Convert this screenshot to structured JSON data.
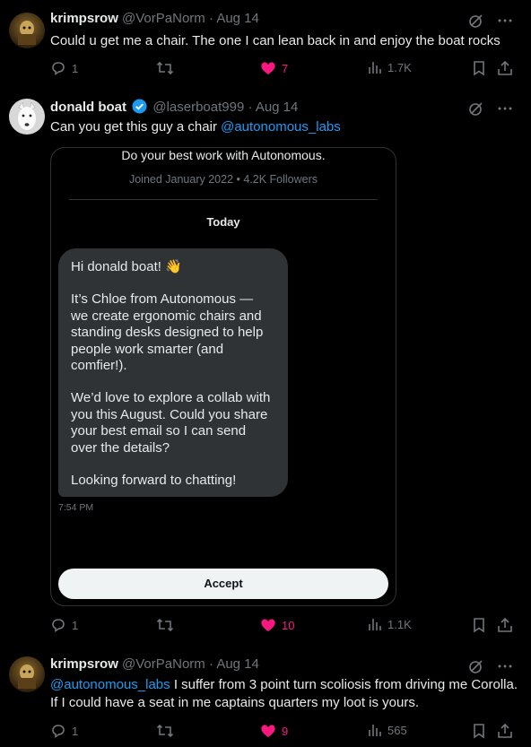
{
  "tweets": [
    {
      "name": "krimpsrow",
      "handle": "@VorPaNorm",
      "sep": "·",
      "date": "Aug 14",
      "text": "Could u get me a chair. The one I can lean back in and enjoy the boat rocks",
      "replies": "1",
      "likes": "7",
      "views": "1.7K"
    },
    {
      "name": "donald boat",
      "handle": "@laserboat999",
      "sep": "·",
      "date": "Aug 14",
      "text_prefix": "Can you get this guy a chair ",
      "mention": "@autonomous_labs",
      "replies": "1",
      "likes": "10",
      "views": "1.1K"
    },
    {
      "name": "krimpsrow",
      "handle": "@VorPaNorm",
      "sep": "·",
      "date": "Aug 14",
      "mention": "@autonomous_labs",
      "text_suffix": " I suffer from 3 point turn scoliosis from driving me Corolla. If I could have a seat in me captains quarters my loot is yours.",
      "replies": "1",
      "likes": "9",
      "views": "565"
    }
  ],
  "card": {
    "tagline": "Do your best work with Autonomous.",
    "joined": "Joined January 2022 • 4.2K Followers",
    "today": "Today",
    "greeting": "Hi donald boat! 👋",
    "para1": "It’s Chloe from Autonomous — we create ergonomic chairs and standing desks designed to help people work smarter (and comfier!).",
    "para2": "We’d love to explore a collab with you this August. Could you share your best email so I can send over the details?",
    "para3": "Looking forward to chatting!",
    "time": "7:54 PM",
    "accept": "Accept"
  },
  "colors": {
    "accent": "#1d9bf0",
    "like": "#f91880",
    "muted": "#71767b"
  }
}
